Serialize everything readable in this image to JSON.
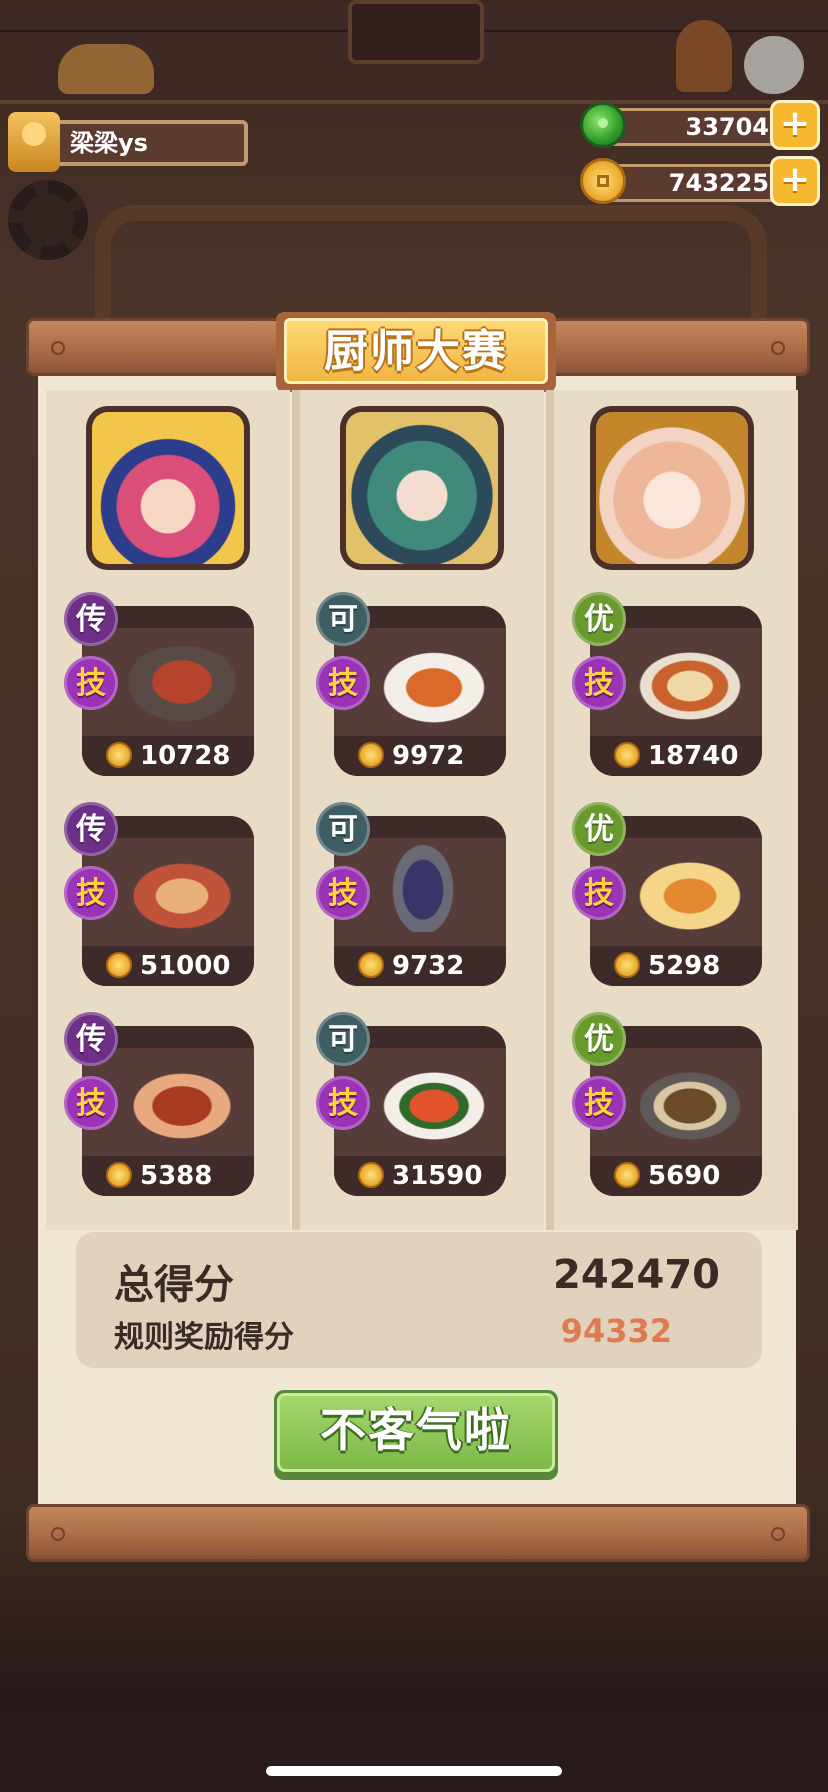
{
  "player": {
    "name": "梁梁ys"
  },
  "currencies": [
    {
      "type": "jade",
      "icon": "jade-icon",
      "value": "33704"
    },
    {
      "type": "coin",
      "icon": "coin-icon",
      "value": "743225"
    }
  ],
  "modal": {
    "title": "厨师大赛",
    "columns": [
      {
        "chef": "chef-avatar-1",
        "dishes": [
          {
            "rank": "传",
            "skill": "技",
            "price": "10728"
          },
          {
            "rank": "传",
            "skill": "技",
            "price": "51000"
          },
          {
            "rank": "传",
            "skill": "技",
            "price": "5388"
          }
        ]
      },
      {
        "chef": "chef-avatar-2",
        "dishes": [
          {
            "rank": "可",
            "skill": "技",
            "price": "9972"
          },
          {
            "rank": "可",
            "skill": "技",
            "price": "9732"
          },
          {
            "rank": "可",
            "skill": "技",
            "price": "31590"
          }
        ]
      },
      {
        "chef": "chef-avatar-3",
        "dishes": [
          {
            "rank": "优",
            "skill": "技",
            "price": "18740"
          },
          {
            "rank": "优",
            "skill": "技",
            "price": "5298"
          },
          {
            "rank": "优",
            "skill": "技",
            "price": "5690"
          }
        ]
      }
    ],
    "total_score_label": "总得分",
    "total_score_value": "242470",
    "bonus_score_label": "规则奖励得分",
    "bonus_score_value": "94332",
    "confirm_label": "不客气啦"
  },
  "colors": {
    "bonus_score": "#e07a50",
    "rank_legend": "#6e2f86",
    "rank_ok": "#3e5e64",
    "rank_good": "#6a9a2e",
    "skill": "#9a33b6",
    "confirm": "#7cb94a"
  }
}
